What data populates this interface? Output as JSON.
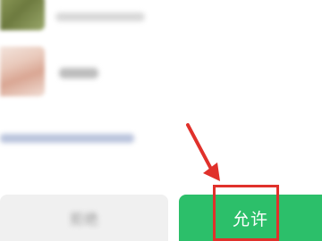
{
  "permission_dialog": {
    "deny_label": "拒绝",
    "allow_label": "允许"
  },
  "annotation": {
    "arrow_color": "#e0312b",
    "box_color": "#e0312b"
  },
  "colors": {
    "allow_button": "#2cbf6a",
    "deny_button": "#f0f0f0"
  }
}
